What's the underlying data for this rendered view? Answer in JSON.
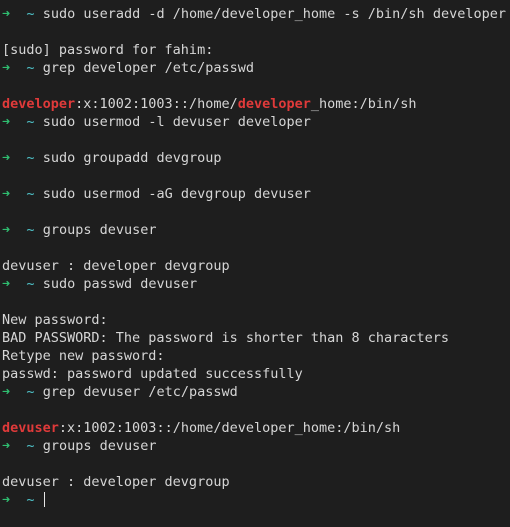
{
  "terminal": {
    "prompt_symbol": "➜",
    "prompt_dir": "~",
    "blocks": [
      {
        "type": "cmd",
        "text": "sudo useradd -d /home/developer_home -s /bin/sh developer"
      },
      {
        "type": "blank"
      },
      {
        "type": "out",
        "text": "[sudo] password for fahim:"
      },
      {
        "type": "cmd",
        "text": "grep developer /etc/passwd"
      },
      {
        "type": "blank"
      },
      {
        "type": "out_hl",
        "parts": [
          {
            "t": "developer",
            "hl": true
          },
          {
            "t": ":x:1002:1003::/home/",
            "hl": false
          },
          {
            "t": "developer",
            "hl": true
          },
          {
            "t": "_home:/bin/sh",
            "hl": false
          }
        ]
      },
      {
        "type": "cmd",
        "text": "sudo usermod -l devuser developer"
      },
      {
        "type": "blank"
      },
      {
        "type": "cmd",
        "text": "sudo groupadd devgroup"
      },
      {
        "type": "blank"
      },
      {
        "type": "cmd",
        "text": "sudo usermod -aG devgroup devuser"
      },
      {
        "type": "blank"
      },
      {
        "type": "cmd",
        "text": "groups devuser"
      },
      {
        "type": "blank"
      },
      {
        "type": "out",
        "text": "devuser : developer devgroup"
      },
      {
        "type": "cmd",
        "text": "sudo passwd devuser"
      },
      {
        "type": "blank"
      },
      {
        "type": "out",
        "text": "New password:"
      },
      {
        "type": "out",
        "text": "BAD PASSWORD: The password is shorter than 8 characters"
      },
      {
        "type": "out",
        "text": "Retype new password:"
      },
      {
        "type": "out",
        "text": "passwd: password updated successfully"
      },
      {
        "type": "cmd",
        "text": "grep devuser /etc/passwd"
      },
      {
        "type": "blank"
      },
      {
        "type": "out_hl",
        "parts": [
          {
            "t": "devuser",
            "hl": true
          },
          {
            "t": ":x:1002:1003::/home/developer_home:/bin/sh",
            "hl": false
          }
        ]
      },
      {
        "type": "cmd",
        "text": "groups devuser"
      },
      {
        "type": "blank"
      },
      {
        "type": "out",
        "text": "devuser : developer devgroup"
      },
      {
        "type": "cmd",
        "text": ""
      }
    ]
  },
  "colors": {
    "background": "#1e1e1e",
    "text": "#d6d6d6",
    "prompt_arrow": "#2fbf71",
    "prompt_dir": "#4fc3c9",
    "highlight": "#e03a3a"
  }
}
